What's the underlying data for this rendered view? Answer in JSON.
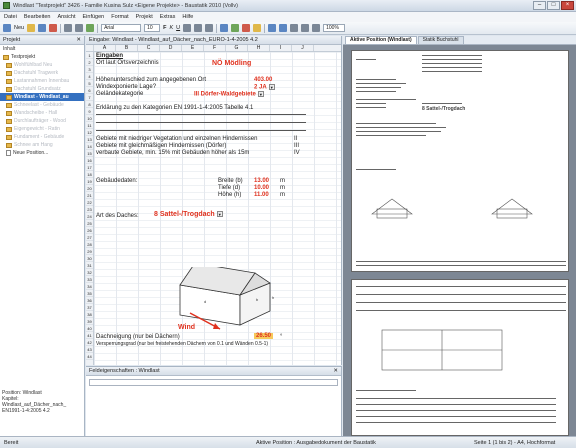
{
  "window": {
    "title": "Windlast \"Testprojekt\" 3426 - Familie Kusina Sulz  <Eigene Projekte> - Baustatik 2010 (Vollv)",
    "buttons": [
      "–",
      "□",
      "×"
    ]
  },
  "menu": [
    "Datei",
    "Bearbeiten",
    "Ansicht",
    "Einfügen",
    "Format",
    "Projekt",
    "Extras",
    "Hilfe"
  ],
  "toolbar": {
    "new_label": "Neu",
    "font": "Arial",
    "size": "10",
    "zoom": "100%"
  },
  "project_panel": {
    "title": "Projekt",
    "subtitle": "Inhalt",
    "items": [
      "Testprojekt",
      "Wohlfühlbad Neu",
      "Dachstuhl Tragwerk",
      "Lastannahmen Innenbau",
      "Dachstuhl Grundsatz",
      "Windlast - Windlast_au",
      "Schneelast - Gebäude",
      "Wandscheibe - Hall",
      "Durchlaufträger - Wood",
      "Eigengewicht - Ratin",
      "Fundament - Gebäude",
      "Schnee am Hang"
    ],
    "new_position": "Neue Position...",
    "info": [
      "Position: Windlast",
      "Kapitel:",
      "Windlast_auf_Dächer_nach_",
      "EN1991-1-4:2005 4.2"
    ]
  },
  "sheet": {
    "header": "Eingabe: Windlast - Windlast_auf_Dächer_nach_EURO-1-4-2005 4.2",
    "columns": [
      "A",
      "B",
      "C",
      "D",
      "E",
      "F",
      "G",
      "H",
      "I",
      "J"
    ],
    "eingaben": "Eingaben",
    "ort_label": "Ort laut Ortsverzeichnis",
    "ort_value": "NÖ Mödling",
    "hoehe_label": "Höhenunterschied zum angegebenen Ort",
    "hoehe_value": "403.00",
    "exponiert_label": "Windexponierte Lage?",
    "exponiert_value": "2 JA",
    "gelaende_label": "Geländekategorie",
    "gelaende_value": "III Dörfer-Waldgebiete",
    "erklaerung": "Erklärung zu den Kategorien EN 1991-1-4:2005 Tabelle 4.1",
    "kat_1": "Gebiete mit niedriger Vegetation und einzelnen Hindernissen",
    "kat_1_num": "II",
    "kat_2": "Gebiete mit gleichmäßigen Hindernissen (Dörfer)",
    "kat_2_num": "III",
    "kat_3": "verbaute Gebiete, min. 15% mit Gebäuden höher als 15m",
    "kat_3_num": "IV",
    "gebaeude_label": "Gebäudedaten:",
    "breite_label": "Breite (b)",
    "breite_value": "13.00",
    "tiefe_label": "Tiefe (d)",
    "tiefe_value": "10.00",
    "hoehe2_label": "Höhe (h)",
    "hoehe2_value": "11.00",
    "unit_m": "m",
    "dach_label": "Art des Daches:",
    "dach_value": "8 Sattel-/Trogdach",
    "wind_label": "Wind",
    "neigung_label": "Dachneigung (nur bei Dächern)",
    "neigung_value": "26.50",
    "neigung_unit": "°",
    "versperr_label": "Versperrungsgrad (nur bei freistehenden Dächern von 0.1 und Wänden 0.5-1)"
  },
  "field_props": {
    "title": "Feldeigenschaften : Windlast"
  },
  "preview": {
    "tabs": [
      "Aktive Position (Windlast)",
      "Statik Buchstuhl"
    ],
    "page_title": "Windlast auf Dächern 8 Sattel-/Trogdach",
    "dach": "8 Sattel-/Trogdach"
  },
  "status": {
    "left": "Bereit",
    "mid": "Aktive Position : Ausgabedokument der Baustatik",
    "right": "Seite 1 (1 bis 2) - A4, Hochformat"
  }
}
